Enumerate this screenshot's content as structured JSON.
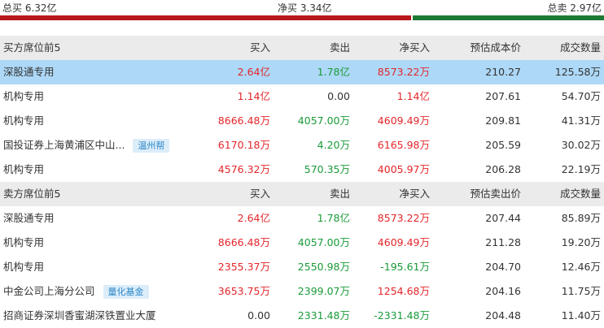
{
  "summary": {
    "total_buy": "总买 6.32亿",
    "net_buy": "净买 3.34亿",
    "total_sell": "总卖 2.97亿",
    "buy_share": 0.68,
    "buy_color": "#b8171b",
    "sell_color": "#1d7a35"
  },
  "buy_section": {
    "headers": [
      "买方席位前5",
      "买入",
      "卖出",
      "净买入",
      "预估成本价",
      "成交数量"
    ],
    "rows": [
      {
        "name": "深股通专用",
        "tag": "",
        "buy": "2.64亿",
        "sell": "1.78亿",
        "net": "8573.22万",
        "price": "210.27",
        "volume": "125.58万",
        "highlight": true,
        "sell_color": "green",
        "net_color": "red"
      },
      {
        "name": "机构专用",
        "tag": "",
        "buy": "1.14亿",
        "sell": "0.00",
        "net": "1.14亿",
        "price": "207.61",
        "volume": "54.70万",
        "sell_color": "plain",
        "net_color": "red"
      },
      {
        "name": "机构专用",
        "tag": "",
        "buy": "8666.48万",
        "sell": "4057.00万",
        "net": "4609.49万",
        "price": "209.81",
        "volume": "41.31万",
        "sell_color": "green",
        "net_color": "red"
      },
      {
        "name": "国投证券上海黄浦区中山...",
        "tag": "温州帮",
        "buy": "6170.18万",
        "sell": "4.20万",
        "net": "6165.98万",
        "price": "205.59",
        "volume": "30.02万",
        "sell_color": "green",
        "net_color": "red"
      },
      {
        "name": "机构专用",
        "tag": "",
        "buy": "4576.32万",
        "sell": "570.35万",
        "net": "4005.97万",
        "price": "206.28",
        "volume": "22.19万",
        "sell_color": "green",
        "net_color": "red"
      }
    ]
  },
  "sell_section": {
    "headers": [
      "卖方席位前5",
      "买入",
      "卖出",
      "净买入",
      "预估卖出价",
      "成交数量"
    ],
    "rows": [
      {
        "name": "深股通专用",
        "tag": "",
        "buy": "2.64亿",
        "sell": "1.78亿",
        "net": "8573.22万",
        "price": "207.44",
        "volume": "85.89万",
        "sell_color": "green",
        "net_color": "red"
      },
      {
        "name": "机构专用",
        "tag": "",
        "buy": "8666.48万",
        "sell": "4057.00万",
        "net": "4609.49万",
        "price": "211.28",
        "volume": "19.20万",
        "sell_color": "green",
        "net_color": "red"
      },
      {
        "name": "机构专用",
        "tag": "",
        "buy": "2355.37万",
        "sell": "2550.98万",
        "net": "-195.61万",
        "price": "204.70",
        "volume": "12.46万",
        "sell_color": "green",
        "net_color": "green"
      },
      {
        "name": "中金公司上海分公司",
        "tag": "量化基金",
        "buy": "3653.75万",
        "sell": "2399.07万",
        "net": "1254.68万",
        "price": "204.16",
        "volume": "11.75万",
        "sell_color": "green",
        "net_color": "red"
      },
      {
        "name": "招商证券深圳香蜜湖深铁置业大厦",
        "tag": "",
        "buy": "0.00",
        "sell": "2331.48万",
        "net": "-2331.48万",
        "price": "204.48",
        "volume": "11.40万",
        "buy_color": "plain",
        "sell_color": "green",
        "net_color": "green"
      }
    ]
  }
}
